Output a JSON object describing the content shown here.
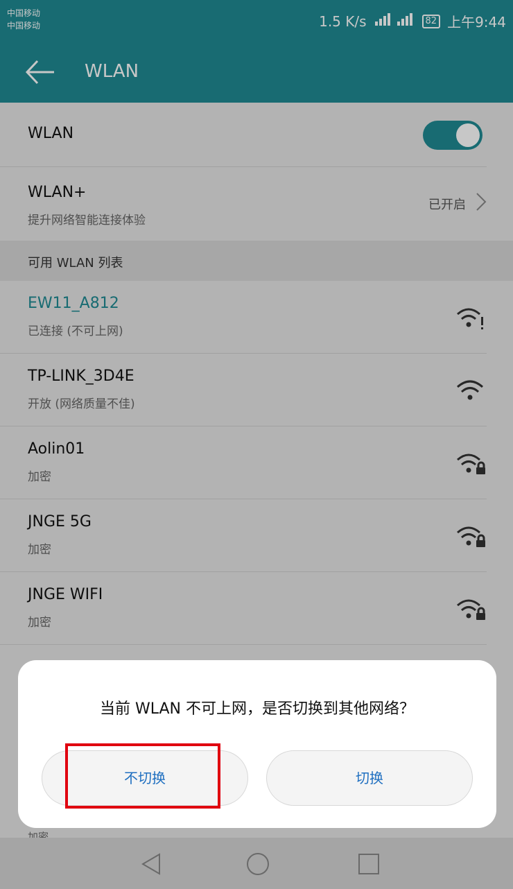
{
  "status_bar": {
    "carrier_1": "中国移动",
    "carrier_2": "中国移动",
    "speed": "1.5 K/s",
    "battery": "82",
    "time": "上午9:44"
  },
  "app_bar": {
    "title": "WLAN"
  },
  "wlan_toggle": {
    "label": "WLAN",
    "state": "on",
    "accent": "#1f8a92"
  },
  "wlan_plus": {
    "title": "WLAN+",
    "subtitle": "提升网络智能连接体验",
    "status": "已开启"
  },
  "section_header": "可用 WLAN 列表",
  "networks": [
    {
      "name": "EW11_A812",
      "status": "已连接 (不可上网)",
      "icon": "wifi-warning-icon"
    },
    {
      "name": "TP-LINK_3D4E",
      "status": "开放 (网络质量不佳)",
      "icon": "wifi-icon"
    },
    {
      "name": "Aolin01",
      "status": "加密",
      "icon": "wifi-lock-icon"
    },
    {
      "name": "JNGE 5G",
      "status": "加密",
      "icon": "wifi-lock-icon"
    },
    {
      "name": "JNGE WIFI",
      "status": "加密",
      "icon": "wifi-lock-icon"
    }
  ],
  "peek_text": "加密",
  "dialog": {
    "message": "当前 WLAN 不可上网，是否切换到其他网络？",
    "cancel_label": "不切换",
    "confirm_label": "切换"
  },
  "colors": {
    "connected_name": "#1f8a92",
    "button_text": "#1f6fc0",
    "highlight_box": "#e0000f"
  }
}
